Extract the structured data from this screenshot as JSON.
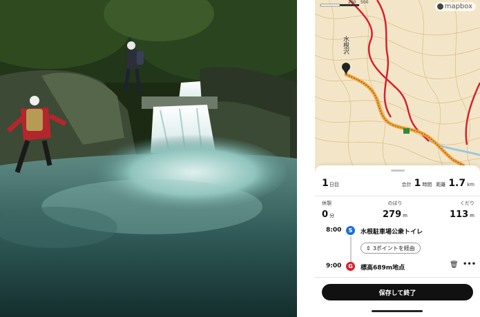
{
  "map": {
    "brand": "mapbox",
    "place_label": "水根沢",
    "scale_labels": [
      "200",
      "500"
    ]
  },
  "summary": {
    "day_num": "1",
    "day_unit": "日目",
    "total_label": "合計",
    "total_value": "1",
    "total_unit": "時間",
    "distance_label": "距離",
    "distance_value": "1.7",
    "distance_unit": "km"
  },
  "stats": {
    "rest": {
      "label": "休憩",
      "value": "0",
      "unit": "分"
    },
    "up": {
      "label": "のぼり",
      "value": "279",
      "unit": "m"
    },
    "down": {
      "label": "くだり",
      "value": "113",
      "unit": "m"
    }
  },
  "route": {
    "start": {
      "time": "8:00",
      "badge": "S",
      "name": "水根駐車場公衆トイレ"
    },
    "via_label": "3ポイントを経由",
    "goal": {
      "time": "9:00",
      "badge": "G",
      "name": "標高689m地点"
    }
  },
  "actions": {
    "save_label": "保存して終了"
  },
  "colors": {
    "route_orange": "#f2a23a",
    "trail_red": "#d8202e",
    "start_blue": "#1a6fd4",
    "goal_red": "#d81e2c"
  }
}
